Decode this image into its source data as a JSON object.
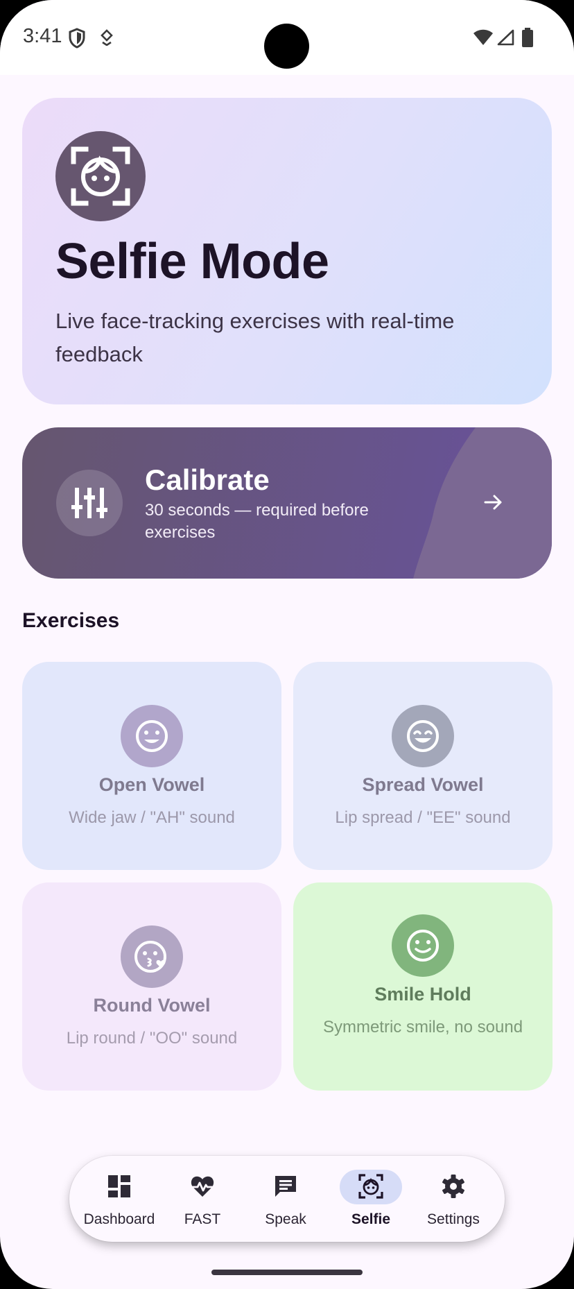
{
  "status_bar": {
    "time": "3:41"
  },
  "hero": {
    "icon": "face-scan-icon",
    "title": "Selfie Mode",
    "subtitle": "Live face-tracking exercises with real-time feedback"
  },
  "calibrate": {
    "icon": "sliders-icon",
    "title": "Calibrate",
    "subtitle": "30 seconds — required before exercises",
    "action_icon": "arrow-right-icon"
  },
  "section": {
    "title": "Exercises"
  },
  "exercises": [
    {
      "icon": "smile-icon",
      "title": "Open Vowel",
      "subtitle": "Wide jaw / \"AH\" sound"
    },
    {
      "icon": "grin-icon",
      "title": "Spread Vowel",
      "subtitle": "Lip spread / \"EE\" sound"
    },
    {
      "icon": "kiss-icon",
      "title": "Round Vowel",
      "subtitle": "Lip round / \"OO\" sound"
    },
    {
      "icon": "smile-icon",
      "title": "Smile Hold",
      "subtitle": "Symmetric smile, no sound"
    }
  ],
  "nav": {
    "items": [
      {
        "label": "Dashboard",
        "icon": "dashboard-icon"
      },
      {
        "label": "FAST",
        "icon": "heart-pulse-icon"
      },
      {
        "label": "Speak",
        "icon": "chat-icon"
      },
      {
        "label": "Selfie",
        "icon": "face-scan-icon",
        "active": true
      },
      {
        "label": "Settings",
        "icon": "gear-icon"
      }
    ]
  },
  "colors": {
    "accent": "#66566f",
    "calibrate_bg": "#675391",
    "background": "#fdf7ff"
  }
}
